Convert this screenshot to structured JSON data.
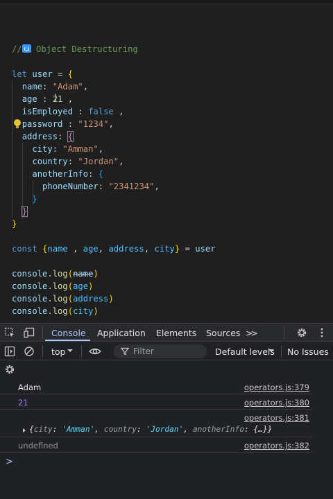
{
  "editor": {
    "lines": {
      "comment_slash": "//",
      "comment_text": " Object Destructuring",
      "let": "let",
      "user": "user",
      "name_key": "name",
      "name_val": "\"Adam\"",
      "age_key": "age",
      "age_val": "21",
      "emp_key": "isEmployed",
      "emp_val": "false",
      "pw_key": "password",
      "pw_val": "\"1234\"",
      "addr_key": "address",
      "city_key": "city",
      "city_val": "\"Amman\"",
      "country_key": "country",
      "country_val": "\"Jordan\"",
      "another_key": "anotherInfo",
      "phone_key": "phoneNumber",
      "phone_val": "\"2341234\"",
      "const": "const",
      "d_name": "name",
      "d_age": "age",
      "d_address": "address",
      "d_city": "city",
      "rhs_user": "user",
      "console": "console",
      "log": "log",
      "arg1": "name",
      "arg2": "age",
      "arg3": "address",
      "arg4": "city"
    }
  },
  "devtools": {
    "tabs": [
      "Console",
      "Application",
      "Elements",
      "Sources"
    ],
    "more": ">>",
    "context": "top",
    "filter_placeholder": "Filter",
    "levels": "Default levels",
    "issues": "No Issues",
    "messages": [
      {
        "text": "Adam",
        "src": "operators.js:379"
      },
      {
        "text": "21",
        "src": "operators.js:380"
      },
      {
        "text": "",
        "src": "operators.js:381"
      },
      {
        "text": "undefined",
        "src": "operators.js:382"
      }
    ],
    "object": {
      "k1": "city",
      "v1": "'Amman'",
      "k2": "country",
      "v2": "'Jordan'",
      "k3": "anotherInfo",
      "v3": "{…}"
    },
    "prompt": ">"
  }
}
